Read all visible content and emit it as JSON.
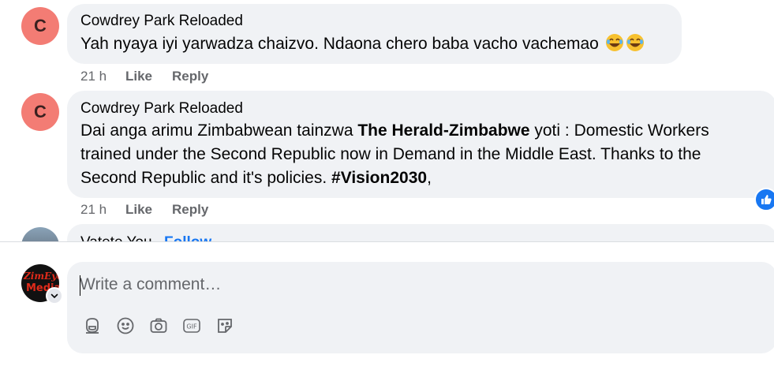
{
  "comments": [
    {
      "avatar_letter": "C",
      "author": "Cowdrey Park Reloaded",
      "text": "Yah nyaya iyi yarwadza chaizvo. Ndaona chero baba vacho vachemao",
      "emojis": [
        "😂",
        "😂"
      ],
      "time": "21 h",
      "like": "Like",
      "reply": "Reply"
    },
    {
      "avatar_letter": "C",
      "author": "Cowdrey Park Reloaded",
      "text_before": "Dai anga arimu Zimbabwean tainzwa ",
      "mention": "The Herald-Zimbabwe",
      "text_middle": " yoti : Domestic Workers trained under the Second Republic now in Demand in the Middle East. Thanks to the Second Republic and it's policies. ",
      "hashtag": "#Vision2030",
      "text_after": ",",
      "time": "21 h",
      "like": "Like",
      "reply": "Reply",
      "reaction_icon": "like-reaction-icon"
    }
  ],
  "peek_comment": {
    "author": "Vatete You",
    "follow": "Follow"
  },
  "composer": {
    "user_logo_line1": "ZimEye",
    "user_logo_line2": "Media",
    "placeholder": "Write a comment…",
    "tools": [
      "avatar-sticker-icon",
      "emoji-icon",
      "camera-icon",
      "gif-icon",
      "sticker-icon"
    ]
  },
  "colors": {
    "bubble": "#f0f2f5",
    "avatar": "#f37c74",
    "accent": "#1877f2",
    "secondary_text": "#65676b"
  }
}
